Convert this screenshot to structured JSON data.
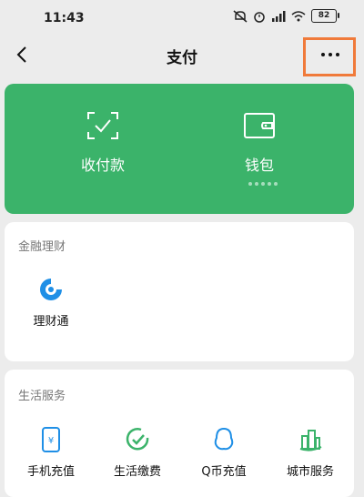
{
  "status_bar": {
    "time": "11:43",
    "battery": "82"
  },
  "header": {
    "title": "支付"
  },
  "wallet_card": {
    "items": [
      {
        "label": "收付款"
      },
      {
        "label": "钱包"
      }
    ]
  },
  "finance": {
    "title": "金融理财",
    "items": [
      {
        "label": "理财通"
      }
    ]
  },
  "life": {
    "title": "生活服务",
    "items": [
      {
        "label": "手机充值"
      },
      {
        "label": "生活缴费"
      },
      {
        "label": "Q币充值"
      },
      {
        "label": "城市服务"
      }
    ]
  },
  "colors": {
    "brand_green": "#3bb36a",
    "highlight": "#f07a3a"
  }
}
